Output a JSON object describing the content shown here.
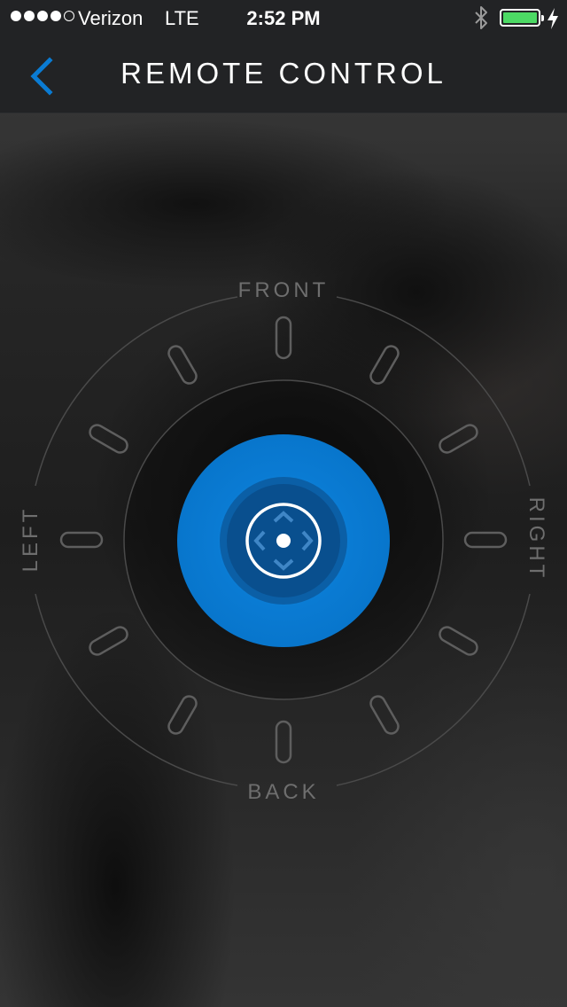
{
  "status_bar": {
    "carrier": "Verizon",
    "network": "LTE",
    "time": "2:52 PM",
    "signal_bars_filled": 4,
    "signal_bars_total": 5,
    "battery_level": 1.0,
    "battery_color": "#4cd964"
  },
  "nav": {
    "title": "REMOTE CONTROL",
    "back_icon": "chevron-left-icon",
    "accent_color": "#0a7bd3"
  },
  "dial": {
    "front_label": "FRONT",
    "back_label": "BACK",
    "left_label": "LEFT",
    "right_label": "RIGHT",
    "joystick_icon": "directional-pad-icon",
    "joystick_color": "#0a7bd3"
  }
}
